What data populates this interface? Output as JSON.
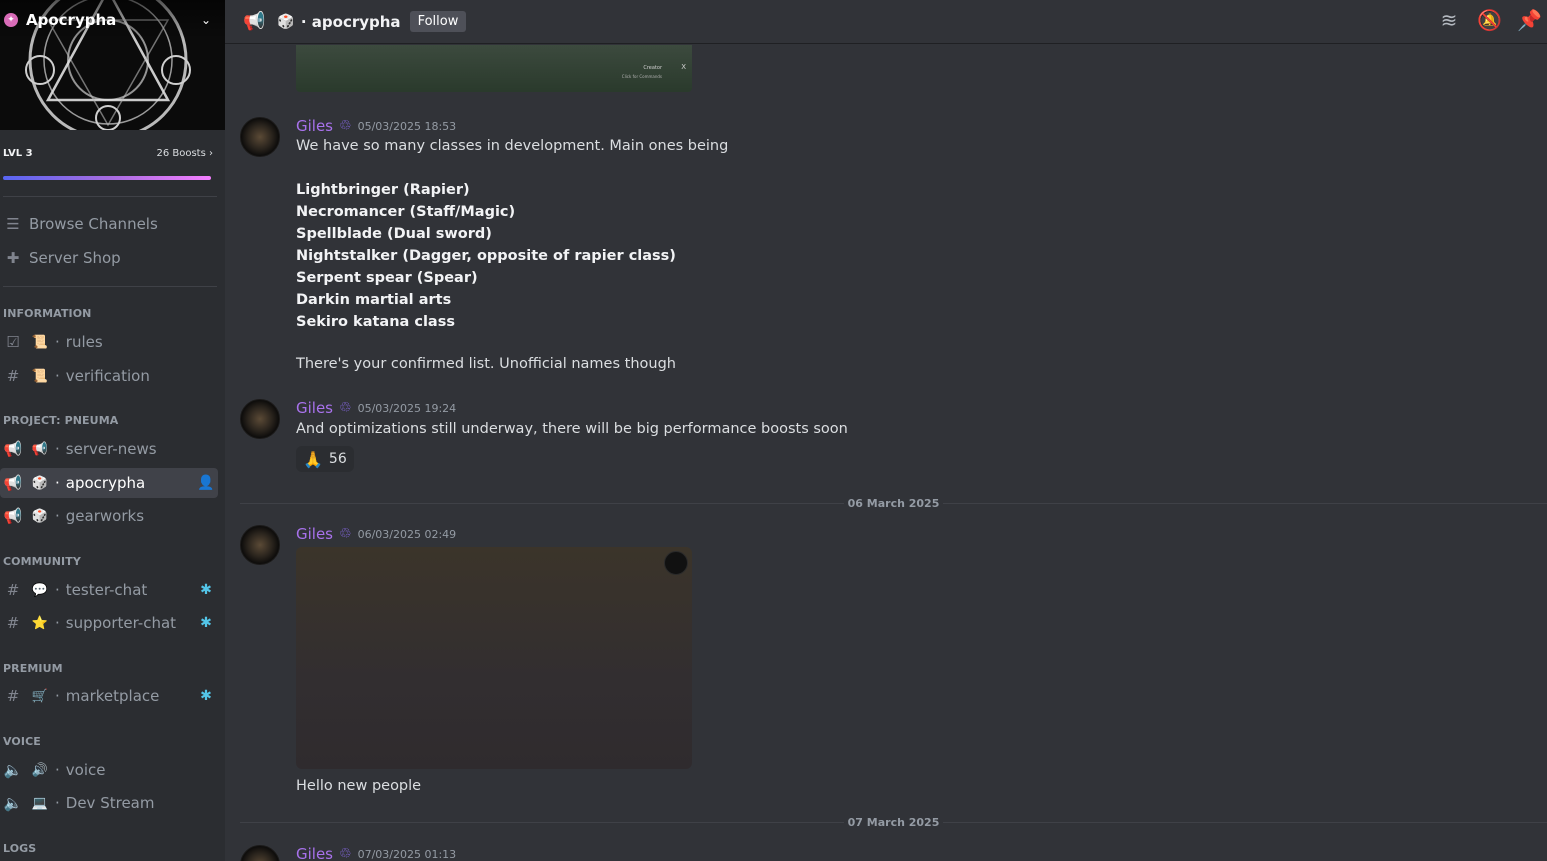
{
  "server": {
    "name": "Apocrypha",
    "level": "LVL 3",
    "boosts": "26 Boosts",
    "boost_progress": 0.97
  },
  "nav": {
    "browse": "Browse Channels",
    "shop": "Server Shop"
  },
  "categories": {
    "information": "INFORMATION",
    "project": "PROJECT: PNEUMA",
    "community": "COMMUNITY",
    "premium": "PREMIUM",
    "voice": "VOICE",
    "logs": "LOGS"
  },
  "channels": {
    "rules": {
      "emoji": "📜",
      "name": "rules"
    },
    "verification": {
      "emoji": "📜",
      "name": "verification"
    },
    "server_news": {
      "emoji": "📢",
      "name": "server-news"
    },
    "apocrypha": {
      "emoji": "🎲",
      "name": "apocrypha"
    },
    "gearworks": {
      "emoji": "🎲",
      "name": "gearworks"
    },
    "tester_chat": {
      "emoji": "💬",
      "name": "tester-chat"
    },
    "supporter_chat": {
      "emoji": "⭐",
      "name": "supporter-chat"
    },
    "marketplace": {
      "emoji": "🛒",
      "name": "marketplace"
    },
    "voice": {
      "emoji": "🔊",
      "name": "voice"
    },
    "dev_stream": {
      "emoji": "💻",
      "name": "Dev Stream"
    }
  },
  "header": {
    "emoji": "🎲",
    "channel": "apocrypha",
    "follow": "Follow"
  },
  "top_image": {
    "title": "Creator",
    "subtitle": "Click for Commands",
    "close": "X"
  },
  "messages": {
    "m1": {
      "author": "Giles",
      "timestamp": "05/03/2025 18:53",
      "intro": "We have so many classes in development. Main ones being",
      "classes": [
        "Lightbringer (Rapier)",
        "Necromancer (Staff/Magic)",
        "Spellblade (Dual sword)",
        "Nightstalker (Dagger, opposite of rapier class)",
        "Serpent spear (Spear)",
        "Darkin martial arts",
        "Sekiro katana class"
      ],
      "outro": "There's your confirmed list. Unofficial names though"
    },
    "m2": {
      "author": "Giles",
      "timestamp": "05/03/2025 19:24",
      "text": "And optimizations still underway, there will be big performance boosts soon",
      "reaction_emoji": "🙏",
      "reaction_count": "56"
    },
    "sep1": "06 March 2025",
    "m3": {
      "author": "Giles",
      "timestamp": "06/03/2025 02:49",
      "text": "Hello new people"
    },
    "sep2": "07 March 2025",
    "m4": {
      "author": "Giles",
      "timestamp": "07/03/2025 01:13"
    }
  },
  "colors": {
    "accent": "#5865f2",
    "author": "#a872ec",
    "bg": "#313338",
    "sidebar": "#2b2d31"
  }
}
